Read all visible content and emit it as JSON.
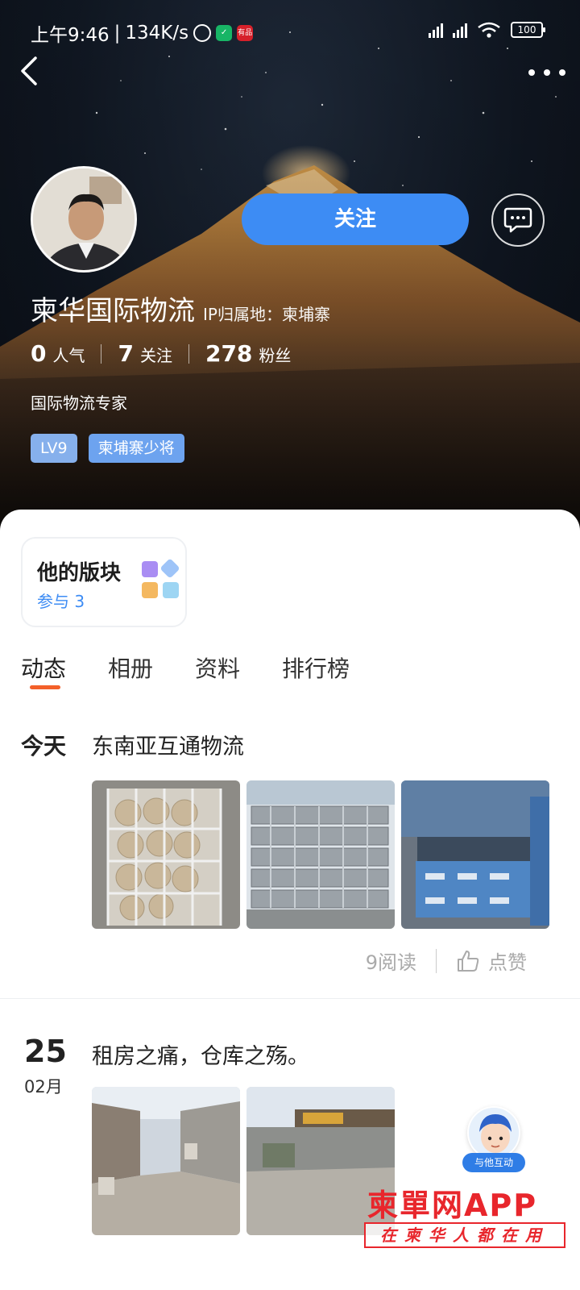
{
  "status_bar": {
    "time": "上午9:46",
    "network_speed": "134K/s",
    "battery": "100",
    "red_icon_text": "有品"
  },
  "profile": {
    "name": "柬华国际物流",
    "ip_location": "IP归属地：柬埔寨",
    "follow_label": "关注",
    "stats": [
      {
        "value": "0",
        "label": "人气"
      },
      {
        "value": "7",
        "label": "关注"
      },
      {
        "value": "278",
        "label": "粉丝"
      }
    ],
    "bio": "国际物流专家",
    "badges": [
      "LV9",
      "柬埔寨少将"
    ]
  },
  "board": {
    "title": "他的版块",
    "count": "参与 3"
  },
  "tabs": [
    "动态",
    "相册",
    "资料",
    "排行榜"
  ],
  "posts": [
    {
      "date": "今天",
      "title": "东南亚互通物流",
      "reads": "9阅读",
      "like_label": "点赞"
    },
    {
      "day": "25",
      "month": "02月",
      "title": "租房之痛，仓库之殇。"
    }
  ],
  "float_button": {
    "label": "与他互动"
  },
  "watermark": {
    "main": "柬單网APP",
    "sub": "在柬华人都在用"
  },
  "icons": [
    "back-icon",
    "more-icon",
    "message-icon",
    "like-icon",
    "alarm-icon",
    "shield-icon",
    "signal-icon",
    "wifi-icon",
    "battery-icon"
  ],
  "colors": {
    "accent": "#3d8cf4",
    "tab_indicator": "#f3602a",
    "watermark": "#e8262c"
  }
}
